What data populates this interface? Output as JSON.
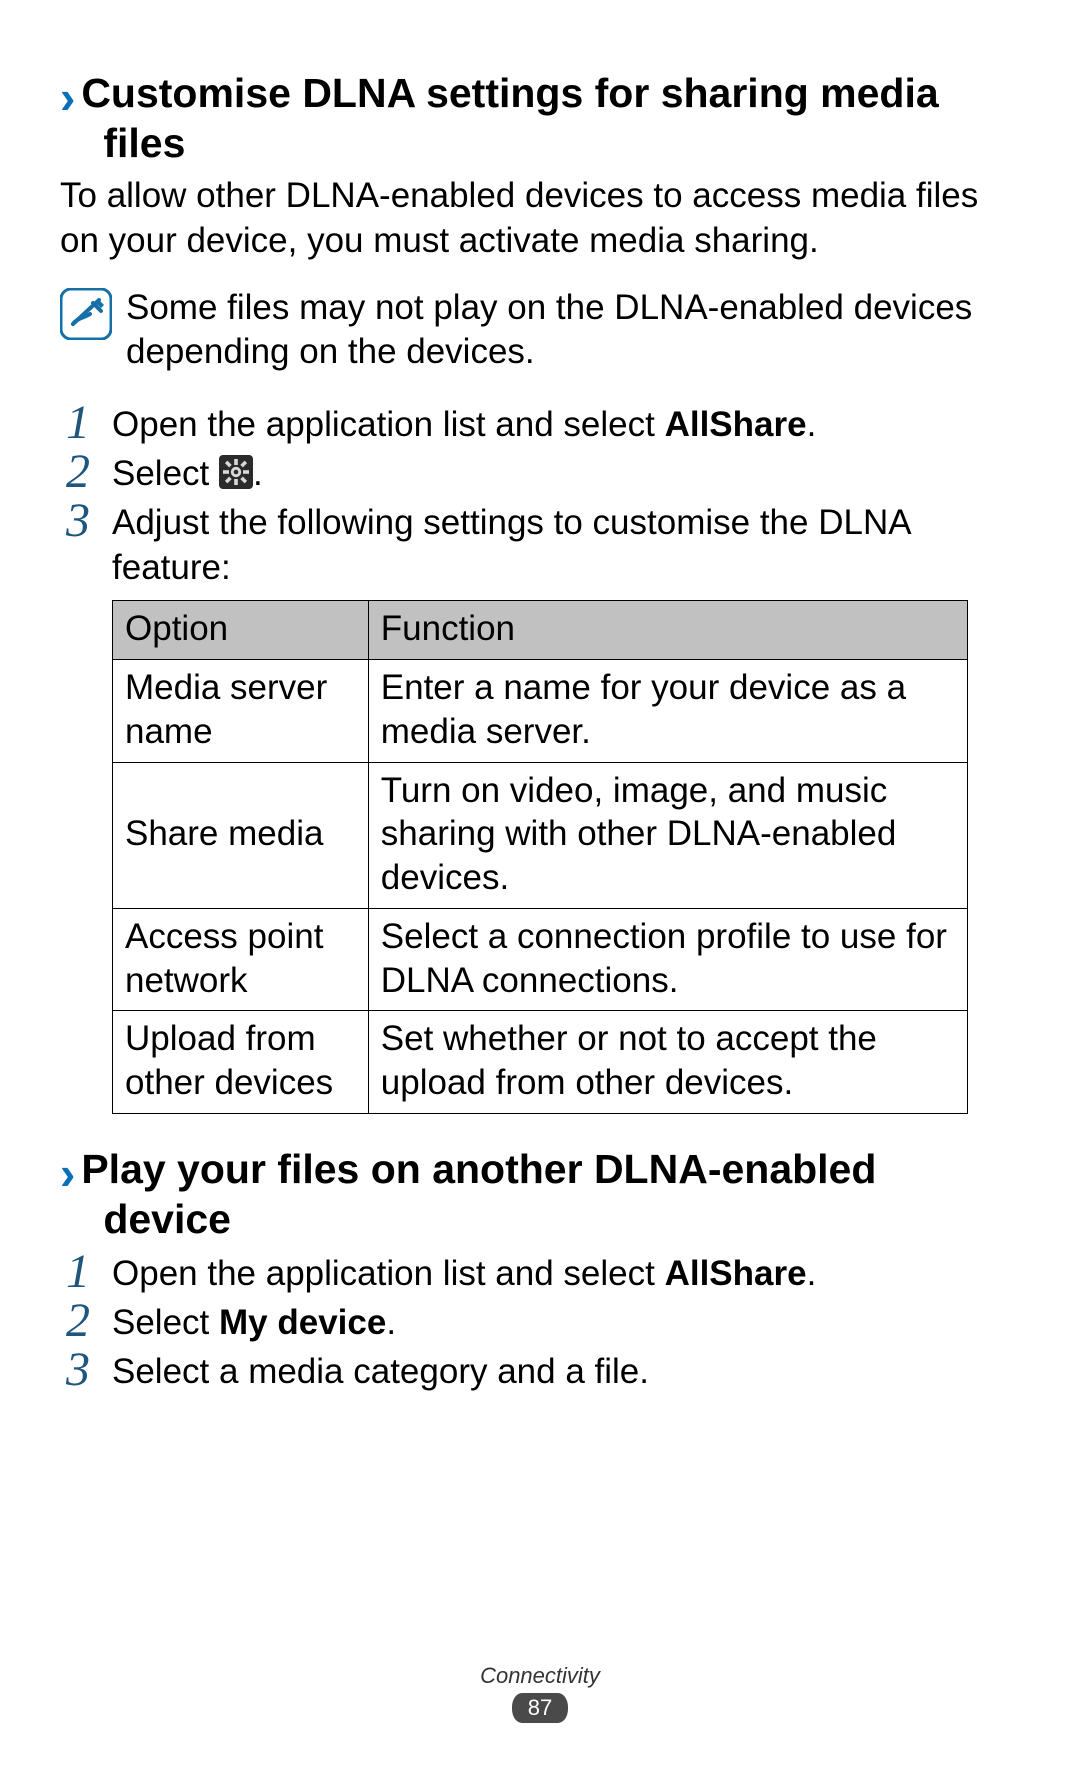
{
  "section1": {
    "chevron": "›",
    "title_line1": "Customise DLNA settings for sharing media",
    "title_line2": "files",
    "intro": "To allow other DLNA-enabled devices to access media files on your device, you must activate media sharing.",
    "note": "Some files may not play on the DLNA-enabled devices depending on the devices.",
    "steps": {
      "s1": {
        "num": "1",
        "prefix": "Open the application list and select ",
        "bold": "AllShare",
        "suffix": "."
      },
      "s2": {
        "num": "2",
        "prefix": "Select ",
        "suffix": "."
      },
      "s3": {
        "num": "3",
        "text": "Adjust the following settings to customise the DLNA feature:"
      }
    },
    "table": {
      "headers": {
        "option": "Option",
        "function": "Function"
      },
      "rows": [
        {
          "option": "Media server name",
          "function": "Enter a name for your device as a media server."
        },
        {
          "option": "Share media",
          "function": "Turn on video, image, and music sharing with other DLNA-enabled devices."
        },
        {
          "option": "Access point network",
          "function": "Select a connection profile to use for DLNA connections."
        },
        {
          "option": "Upload from other devices",
          "function": "Set whether or not to accept the upload from other devices."
        }
      ]
    }
  },
  "section2": {
    "chevron": "›",
    "title_line1": "Play your files on another DLNA-enabled",
    "title_line2": "device",
    "steps": {
      "s1": {
        "num": "1",
        "prefix": "Open the application list and select ",
        "bold": "AllShare",
        "suffix": "."
      },
      "s2": {
        "num": "2",
        "prefix": "Select ",
        "bold": "My device",
        "suffix": "."
      },
      "s3": {
        "num": "3",
        "text": "Select a media category and a file."
      }
    }
  },
  "footer": {
    "category": "Connectivity",
    "page": "87"
  }
}
